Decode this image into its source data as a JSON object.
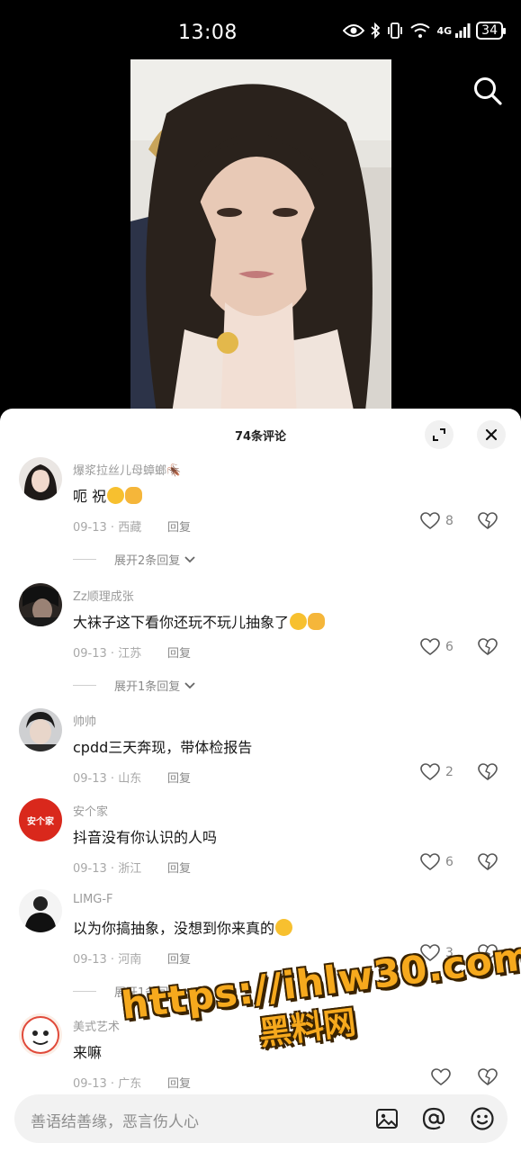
{
  "status_bar": {
    "time": "13:08",
    "signal": "4G",
    "battery": "34"
  },
  "header": {
    "title": "74条评论"
  },
  "comments": [
    {
      "user": "爆浆拉丝儿母蟑螂🪳",
      "text": "呃 祝",
      "emojis": [
        "laugh-cry",
        "ok-hand"
      ],
      "date": "09-13",
      "location": "西藏",
      "reply": "回复",
      "likes": "8",
      "expand": "展开2条回复"
    },
    {
      "user": "Zz顺理成张",
      "text": "大袜子这下看你还玩不玩儿抽象了",
      "emojis": [
        "laugh-cry",
        "ok-hand"
      ],
      "date": "09-13",
      "location": "江苏",
      "reply": "回复",
      "likes": "6",
      "expand": "展开1条回复"
    },
    {
      "user": "帅帅",
      "text": "cpdd三天奔现，带体检报告",
      "emojis": [],
      "date": "09-13",
      "location": "山东",
      "reply": "回复",
      "likes": "2",
      "expand": ""
    },
    {
      "user": "安个家",
      "text": "抖音没有你认识的人吗",
      "emojis": [],
      "date": "09-13",
      "location": "浙江",
      "reply": "回复",
      "likes": "6",
      "expand": ""
    },
    {
      "user": "LIMG-F",
      "text": "以为你搞抽象，没想到你来真的",
      "emojis": [
        "eye-roll"
      ],
      "date": "09-13",
      "location": "河南",
      "reply": "回复",
      "likes": "3",
      "expand": "展开1条回复"
    },
    {
      "user": "美式艺术",
      "text": "来嘛",
      "emojis": [],
      "date": "09-13",
      "location": "广东",
      "reply": "回复",
      "likes": "",
      "expand": ""
    }
  ],
  "avatar_badge": {
    "text": "安个家"
  },
  "input": {
    "placeholder": "善语结善缘，恶言伤人心"
  },
  "watermark": {
    "url": "https://ihlw30.com",
    "cn": "黑料网"
  },
  "colors": {
    "accent": "#f6a91d",
    "sheet_bg": "#ffffff",
    "muted": "#9b9b9b"
  },
  "icons": {
    "search": "search-icon",
    "expand": "expand-icon",
    "close": "close-icon",
    "like": "heart-icon",
    "dislike": "broken-heart-icon",
    "image": "image-icon",
    "mention": "at-icon",
    "emoji": "emoji-icon"
  }
}
